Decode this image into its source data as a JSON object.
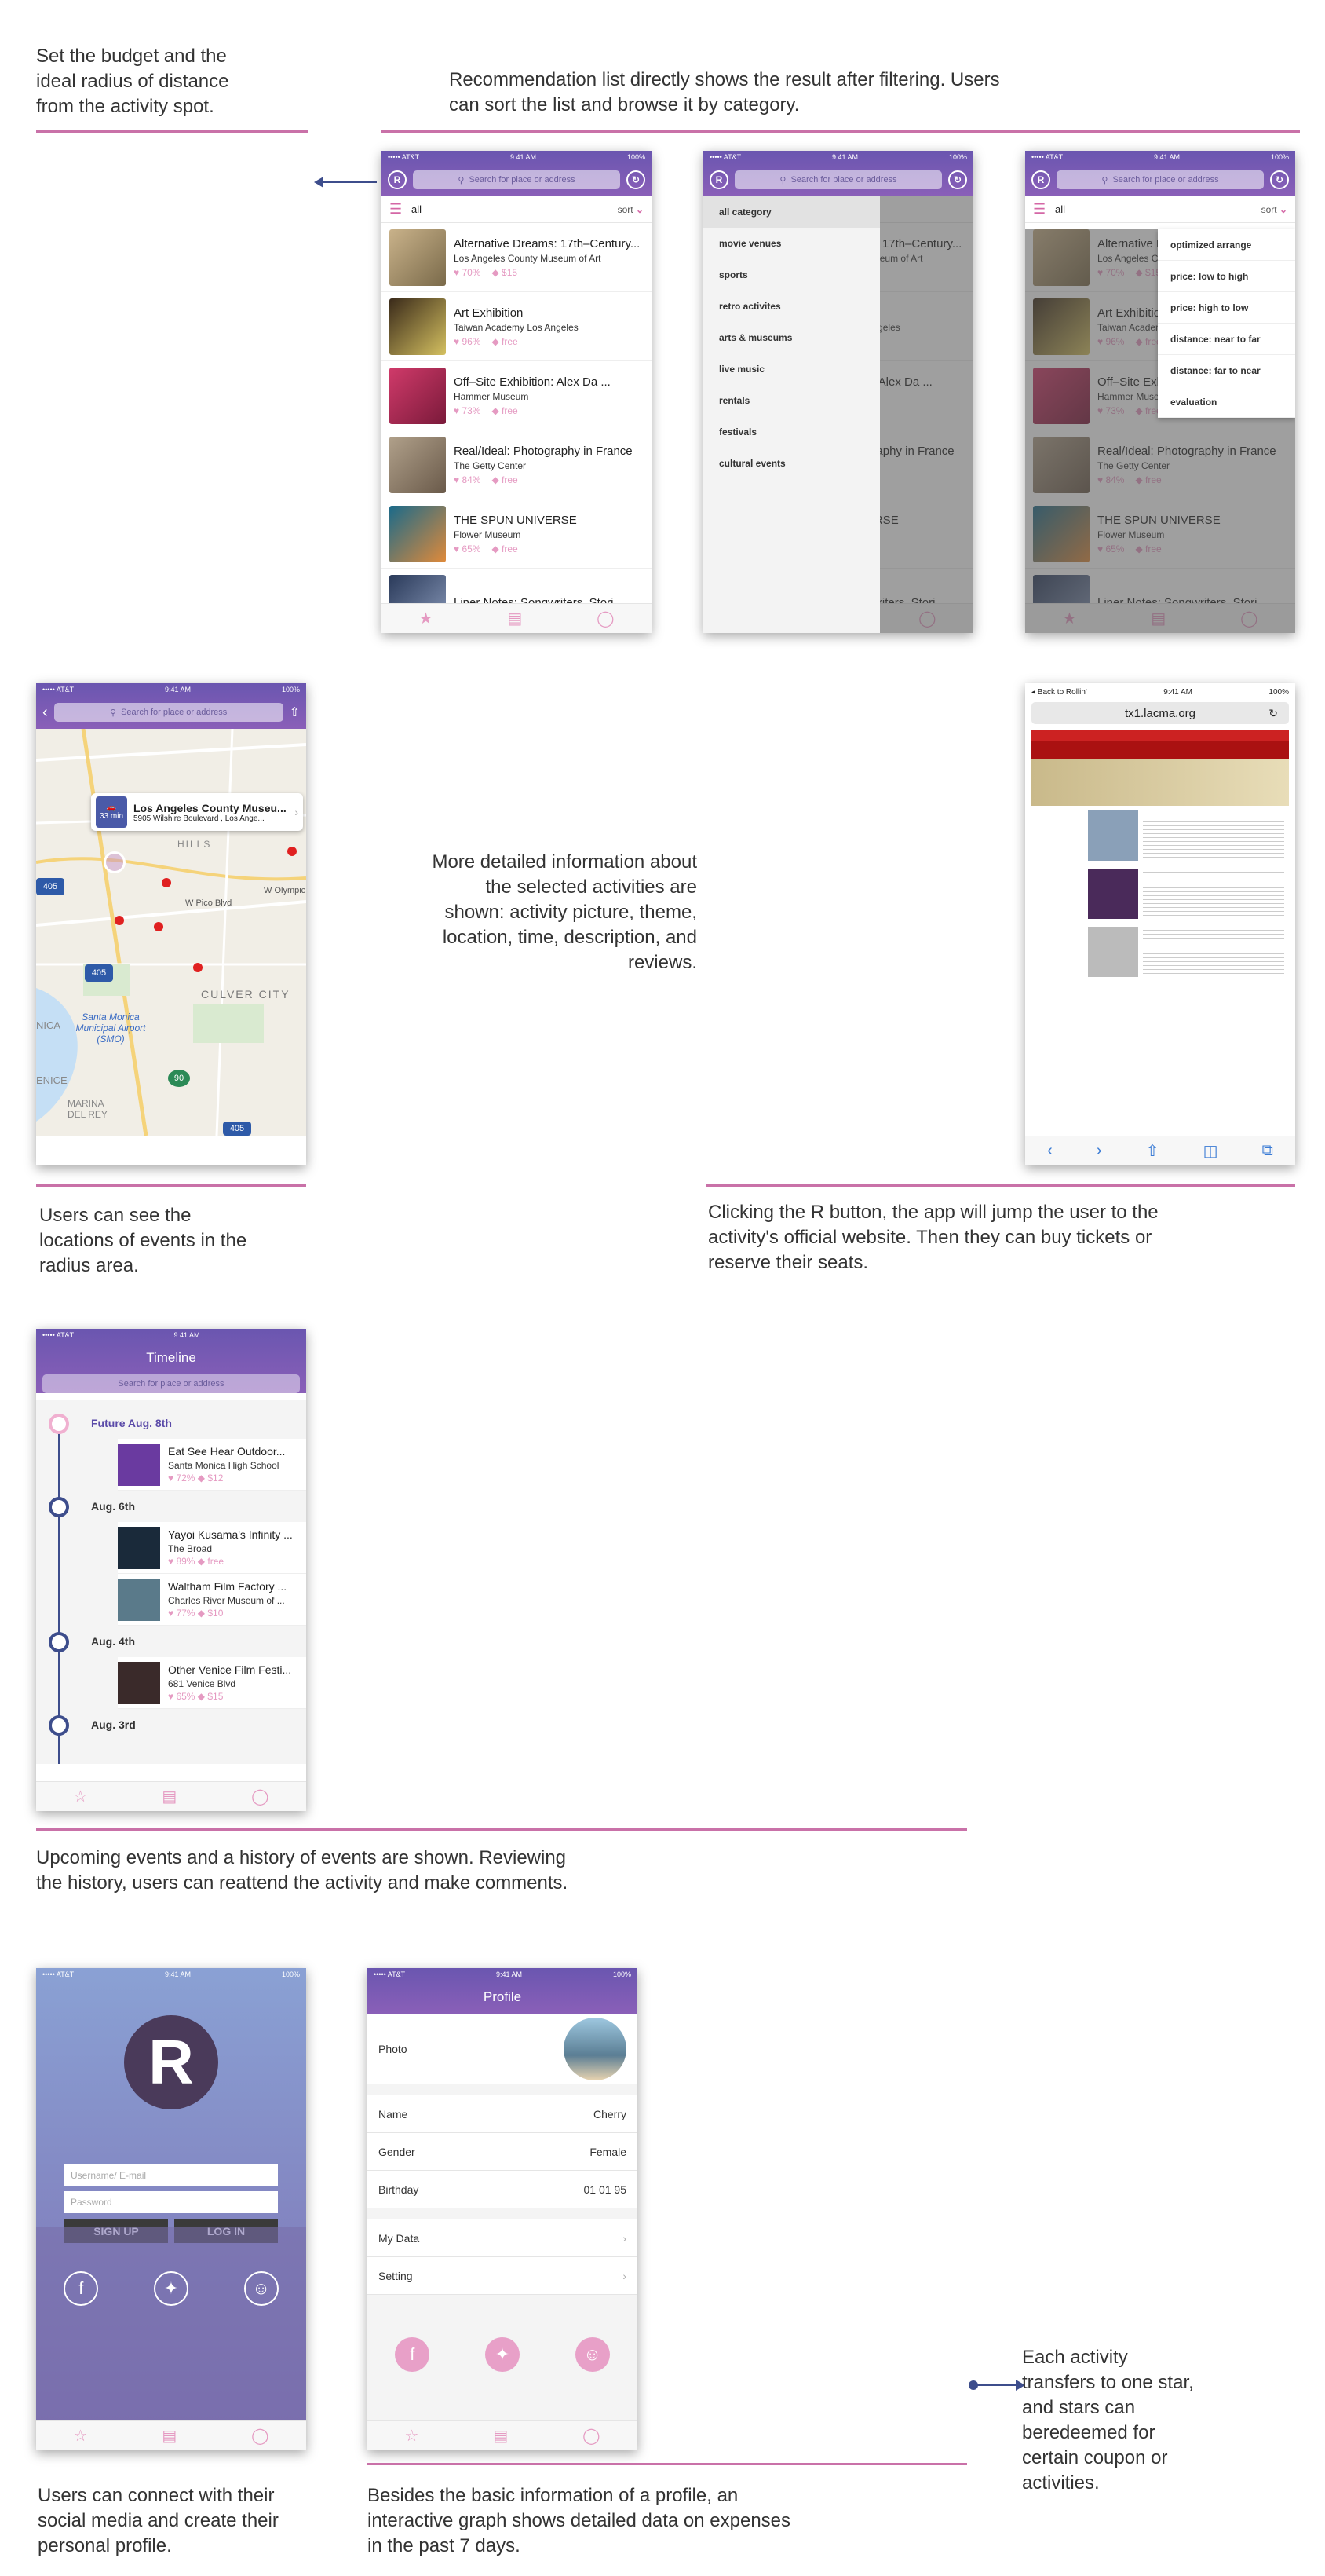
{
  "notes": {
    "budget": "Set the budget and the ideal radius of distance from the activity spot.",
    "recommend": "Recommendation list directly shows the result after filtering. Users can sort the list and browse it by category.",
    "detail": "More detailed information about the selected activities are shown:  activity picture, theme, location, time, description, and reviews.",
    "map": "Users can see the locations of events in the radius area.",
    "rbutton": "Clicking the R button, the app will jump the user to the activity's official website. Then they can buy tickets or reserve their seats.",
    "timeline": "Upcoming events and a history of events are shown. Reviewing the history, users can reattend the activity and make comments.",
    "social": "Users can connect with their social media and create their personal profile.",
    "profile": "Besides the basic information of a profile, an interactive graph shows detailed data on expenses in the past 7 days.",
    "stars": "Each activity transfers to one star, and stars can beredeemed for certain coupon or activities."
  },
  "status": {
    "carrier": "••••• AT&T",
    "time": "9:41 AM",
    "battery": "100%"
  },
  "search_placeholder": "Search for place or address",
  "filter": {
    "label": "all",
    "sort": "sort"
  },
  "activities": [
    {
      "title": "Alternative Dreams: 17th–Century...",
      "venue": "Los Angeles County Museum of Art",
      "rating": "70%",
      "price": "$15"
    },
    {
      "title": "Art Exhibition",
      "venue": "Taiwan Academy Los Angeles",
      "rating": "96%",
      "price": "free"
    },
    {
      "title": "Off–Site Exhibition: Alex Da ...",
      "venue": "Hammer Museum",
      "rating": "73%",
      "price": "free"
    },
    {
      "title": "Real/Ideal: Photography in France",
      "venue": "The Getty Center",
      "rating": "84%",
      "price": "free"
    },
    {
      "title": "THE SPUN UNIVERSE",
      "venue": "Flower Museum",
      "rating": "65%",
      "price": "free"
    },
    {
      "title": "Liner Notes: Songwriters, Stori...",
      "venue": "",
      "rating": "",
      "price": ""
    }
  ],
  "categories": [
    "all category",
    "movie venues",
    "sports",
    "retro activites",
    "arts & museums",
    "live music",
    "rentals",
    "festivals",
    "cultural events"
  ],
  "sort_options": [
    "optimized arrange",
    "price: low to high",
    "price: high to low",
    "distance: near to far",
    "distance: far to near",
    "evaluation"
  ],
  "map": {
    "callout_title": "Los Angeles County Museu...",
    "callout_addr": "5905 Wilshire Boulevard , Los Ange...",
    "drive_time": "33 min",
    "labels": {
      "hills": "HILLS",
      "pico": "W Pico Blvd",
      "olympic": "W Olympic",
      "culver": "CULVER CITY",
      "airport": "Santa Monica Municipal Airport (SMO)",
      "marina": "MARINA DEL REY",
      "nica": "NICA",
      "venice": "ENICE"
    },
    "shields": [
      "405",
      "405",
      "405",
      "90"
    ]
  },
  "browser": {
    "back": "◂ Back to Rollin'",
    "time": "9:41 AM",
    "battery": "100%",
    "url": "tx1.lacma.org"
  },
  "timeline": {
    "title": "Timeline",
    "groups": [
      {
        "date": "Future Aug. 8th",
        "items": [
          {
            "title": "Eat See Hear Outdoor...",
            "venue": "Santa Monica High School",
            "rating": "72%",
            "price": "$12"
          }
        ]
      },
      {
        "date": "Aug. 6th",
        "items": [
          {
            "title": "Yayoi Kusama's Infinity ...",
            "venue": "The Broad",
            "rating": "89%",
            "price": "free"
          },
          {
            "title": "Waltham Film Factory ...",
            "venue": "Charles River Museum of ...",
            "rating": "77%",
            "price": "$10"
          }
        ]
      },
      {
        "date": "Aug. 4th",
        "items": [
          {
            "title": "Other Venice Film Festi...",
            "venue": "681 Venice Blvd",
            "rating": "65%",
            "price": "$15"
          }
        ]
      },
      {
        "date": "Aug. 3rd",
        "items": []
      }
    ]
  },
  "login": {
    "username_placeholder": "Username/ E-mail",
    "password_placeholder": "Password",
    "signup": "SIGN UP",
    "login": "LOG IN"
  },
  "profile": {
    "title": "Profile",
    "photo": "Photo",
    "rows": [
      {
        "label": "Name",
        "value": "Cherry"
      },
      {
        "label": "Gender",
        "value": "Female"
      },
      {
        "label": "Birthday",
        "value": "01 01 95"
      }
    ],
    "links": [
      "My Data",
      "Setting"
    ]
  },
  "colors": {
    "accent": "#d467a6",
    "header": "#6a56b0",
    "rule": "#c971a8"
  }
}
